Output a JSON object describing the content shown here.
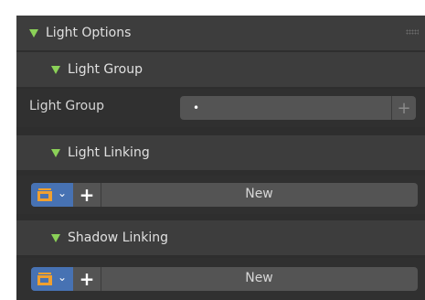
{
  "sections": {
    "light_options": {
      "label": "Light Options"
    },
    "light_group": {
      "label": "Light Group"
    },
    "light_linking": {
      "label": "Light Linking"
    },
    "shadow_linking": {
      "label": "Shadow Linking"
    }
  },
  "light_group_row": {
    "label": "Light Group",
    "value": "•"
  },
  "light_linking_row": {
    "new_label": "New"
  },
  "shadow_linking_row": {
    "new_label": "New"
  },
  "icons": {
    "expand": "triangle-down-icon",
    "collection": "collection-icon",
    "add": "plus-icon",
    "grip": "drag-grip-icon"
  },
  "colors": {
    "accent_triangle": "#8bd158",
    "selector_blue": "#4772b3",
    "field_bg": "#545454"
  }
}
